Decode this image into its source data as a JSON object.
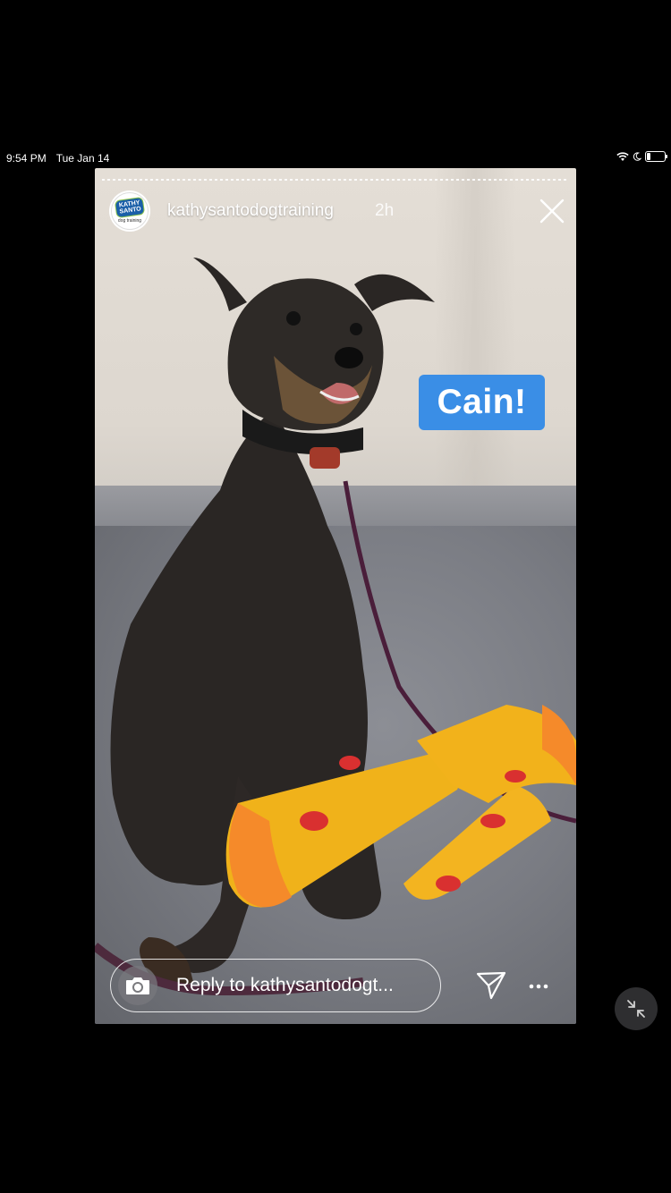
{
  "status_bar": {
    "time": "9:54 PM",
    "date": "Tue Jan 14",
    "icons": [
      "wifi-icon",
      "moon-icon",
      "battery-icon"
    ]
  },
  "story": {
    "username": "kathysantodogtraining",
    "time_ago": "2h",
    "avatar": {
      "logo_line1": "KATHY",
      "logo_line2": "SANTO",
      "logo_sub": "dog training"
    },
    "sticker_text": "Cain!",
    "sticker_color": "#3a8ee6",
    "image_subject": "dog-with-pizza-toys"
  },
  "reply": {
    "placeholder": "Reply to kathysantodogt..."
  },
  "icons": {
    "close": "close-icon",
    "camera": "camera-icon",
    "send": "send-icon",
    "more": "more-icon",
    "minimize": "minimize-icon"
  }
}
